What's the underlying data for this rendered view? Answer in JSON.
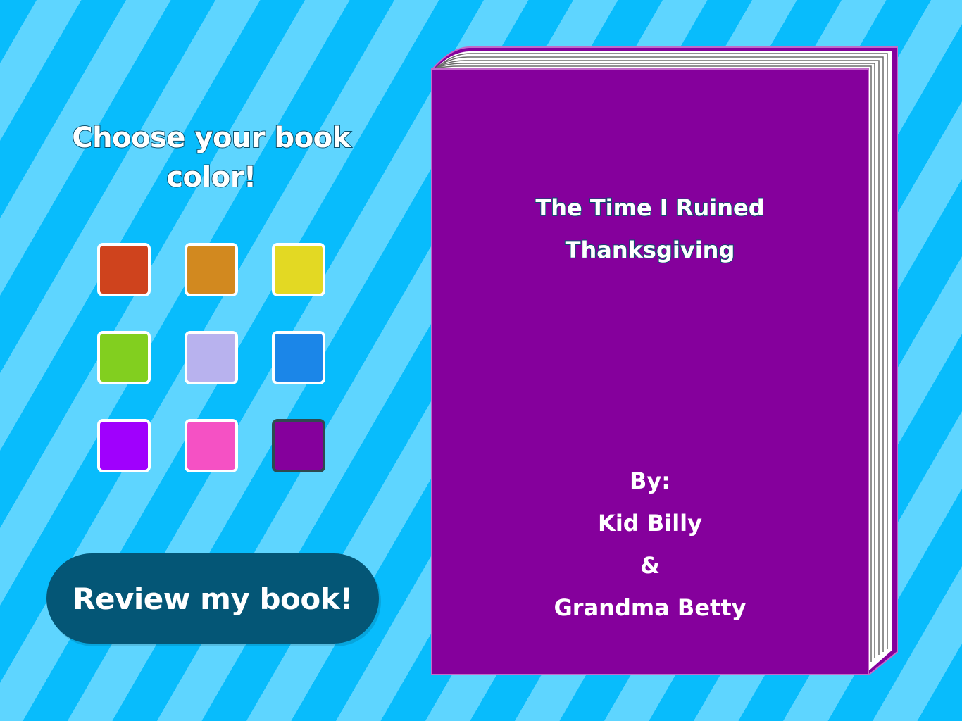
{
  "heading": {
    "line1": "Choose your book",
    "line2": "color!"
  },
  "colors": {
    "swatches": [
      {
        "name": "red-orange",
        "hex": "#cf431d"
      },
      {
        "name": "orange",
        "hex": "#d2891f"
      },
      {
        "name": "yellow",
        "hex": "#e3d923"
      },
      {
        "name": "green",
        "hex": "#82cf1f"
      },
      {
        "name": "lavender",
        "hex": "#b8b2ee"
      },
      {
        "name": "blue",
        "hex": "#1b86e8"
      },
      {
        "name": "violet",
        "hex": "#a000fd"
      },
      {
        "name": "pink",
        "hex": "#f551c4"
      },
      {
        "name": "purple",
        "hex": "#85009c"
      }
    ],
    "selected_index": 8
  },
  "review_button": {
    "label": "Review my book!"
  },
  "book": {
    "cover_color": "#85009c",
    "title_line1": "The Time I Ruined",
    "title_line2": "Thanksgiving",
    "by_label": "By:",
    "author1": "Kid Billy",
    "ampersand": "&",
    "author2": "Grandma Betty"
  }
}
